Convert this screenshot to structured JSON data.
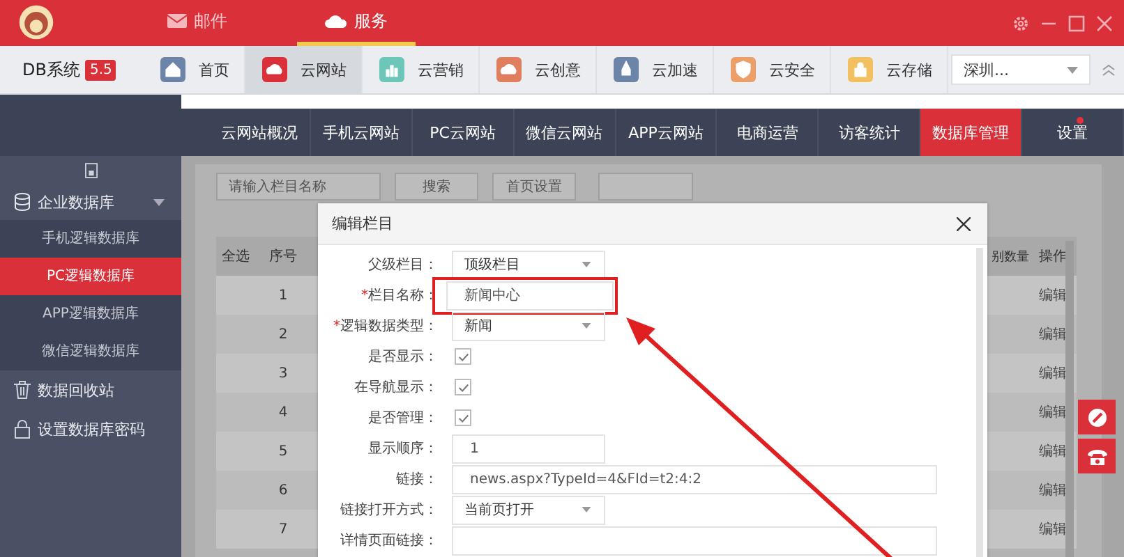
{
  "titlebar": {
    "tabs": [
      {
        "label": "邮件",
        "selected": false
      },
      {
        "label": "服务",
        "selected": true
      }
    ]
  },
  "toolbar": {
    "brand": "DB系统",
    "version": "5.5",
    "items": [
      {
        "label": "首页",
        "selected": false,
        "color": "#6b84a8"
      },
      {
        "label": "云网站",
        "selected": true,
        "color": "#d9303a"
      },
      {
        "label": "云营销",
        "selected": false,
        "color": "#6cc7b9"
      },
      {
        "label": "云创意",
        "selected": false,
        "color": "#e07f5f"
      },
      {
        "label": "云加速",
        "selected": false,
        "color": "#6b84a8"
      },
      {
        "label": "云安全",
        "selected": false,
        "color": "#eba06a"
      },
      {
        "label": "云存储",
        "selected": false,
        "color": "#f2c061"
      }
    ],
    "city": "深圳..."
  },
  "nav": {
    "items": [
      {
        "label": "云网站概况",
        "selected": false,
        "badge": false
      },
      {
        "label": "手机云网站",
        "selected": false,
        "badge": false
      },
      {
        "label": "PC云网站",
        "selected": false,
        "badge": false
      },
      {
        "label": "微信云网站",
        "selected": false,
        "badge": false
      },
      {
        "label": "APP云网站",
        "selected": false,
        "badge": false
      },
      {
        "label": "电商运营",
        "selected": false,
        "badge": false
      },
      {
        "label": "访客统计",
        "selected": false,
        "badge": false
      },
      {
        "label": "数据库管理",
        "selected": true,
        "badge": false
      },
      {
        "label": "设置",
        "selected": false,
        "badge": true
      }
    ]
  },
  "sidebar": {
    "group": {
      "label": "企业数据库",
      "expanded": true,
      "children": [
        {
          "label": "手机逻辑数据库",
          "selected": false
        },
        {
          "label": "PC逻辑数据库",
          "selected": true
        },
        {
          "label": "APP逻辑数据库",
          "selected": false
        },
        {
          "label": "微信逻辑数据库",
          "selected": false
        }
      ]
    },
    "items": [
      {
        "label": "数据回收站"
      },
      {
        "label": "设置数据库密码"
      }
    ]
  },
  "content": {
    "search": {
      "placeholder": "请输入栏目名称"
    },
    "buttons": [
      "搜索",
      "首页设置"
    ],
    "table": {
      "columns": [
        "全选",
        "序号",
        "别数量",
        "操作"
      ],
      "rows": [
        {
          "index": "1",
          "action": "编辑"
        },
        {
          "index": "2",
          "action": "编辑"
        },
        {
          "index": "3",
          "action": "编辑"
        },
        {
          "index": "4",
          "action": "编辑"
        },
        {
          "index": "5",
          "action": "编辑"
        },
        {
          "index": "6",
          "action": "编辑"
        },
        {
          "index": "7",
          "action": "编辑"
        }
      ]
    }
  },
  "dialog": {
    "title": "编辑栏目",
    "fields": [
      {
        "kind": "select",
        "label": "父级栏目：",
        "value": "顶级栏目"
      },
      {
        "kind": "input",
        "label": "栏目名称：",
        "required": "*",
        "value": "新闻中心",
        "highlighted": true
      },
      {
        "kind": "select",
        "label": "逻辑数据类型：",
        "required": "*",
        "value": "新闻"
      },
      {
        "kind": "checkbox",
        "label": "是否显示：",
        "checked": true
      },
      {
        "kind": "checkbox",
        "label": "在导航显示：",
        "checked": true
      },
      {
        "kind": "checkbox",
        "label": "是否管理：",
        "checked": true
      },
      {
        "kind": "input",
        "label": "显示顺序：",
        "value": "1",
        "highlighted": false
      },
      {
        "kind": "wide",
        "label": "链接：",
        "value": "news.aspx?TypeId=4&FId=t2:4:2",
        "highlighted": false
      },
      {
        "kind": "select",
        "label": "链接打开方式：",
        "value": "当前页打开"
      },
      {
        "kind": "wide",
        "label": "详情页面链接：",
        "highlighted": false
      }
    ]
  }
}
